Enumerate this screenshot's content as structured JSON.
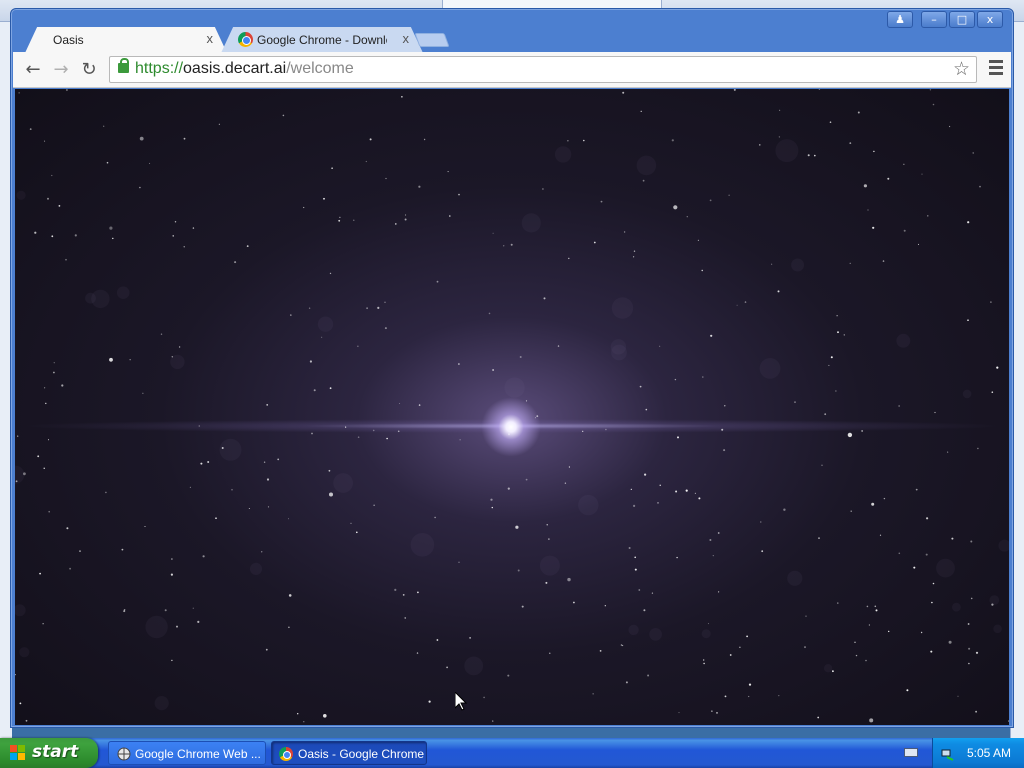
{
  "browser": {
    "tabs": [
      {
        "title": "Oasis",
        "active": true
      },
      {
        "title": "Google Chrome - Download t",
        "active": false
      }
    ],
    "address": {
      "scheme": "https://",
      "host": "oasis.decart.ai",
      "path": "/welcome"
    },
    "window_controls": {
      "user": "♟",
      "minimize": "–",
      "maximize": "□",
      "close": "x"
    },
    "nav": {
      "back": "←",
      "forward": "→",
      "reload": "↻"
    },
    "star": "☆",
    "tab_close": "x"
  },
  "page": {
    "background": "starfield",
    "colors": {
      "space": "#1b1727",
      "glow": "#5a4c7a",
      "star": "#ffffff"
    }
  },
  "taskbar": {
    "start_label": "start",
    "tasks": [
      {
        "label": "Google Chrome Web ...",
        "icon": "web-icon",
        "active": false
      },
      {
        "label": "Oasis - Google Chrome",
        "icon": "chrome-icon",
        "active": true
      }
    ],
    "clock": "5:05 AM"
  },
  "colors": {
    "taskbar": "#2458d0",
    "start_button": "#3ea23e",
    "tray": "#0f8ce3",
    "url_scheme": "#2e8b2e"
  }
}
